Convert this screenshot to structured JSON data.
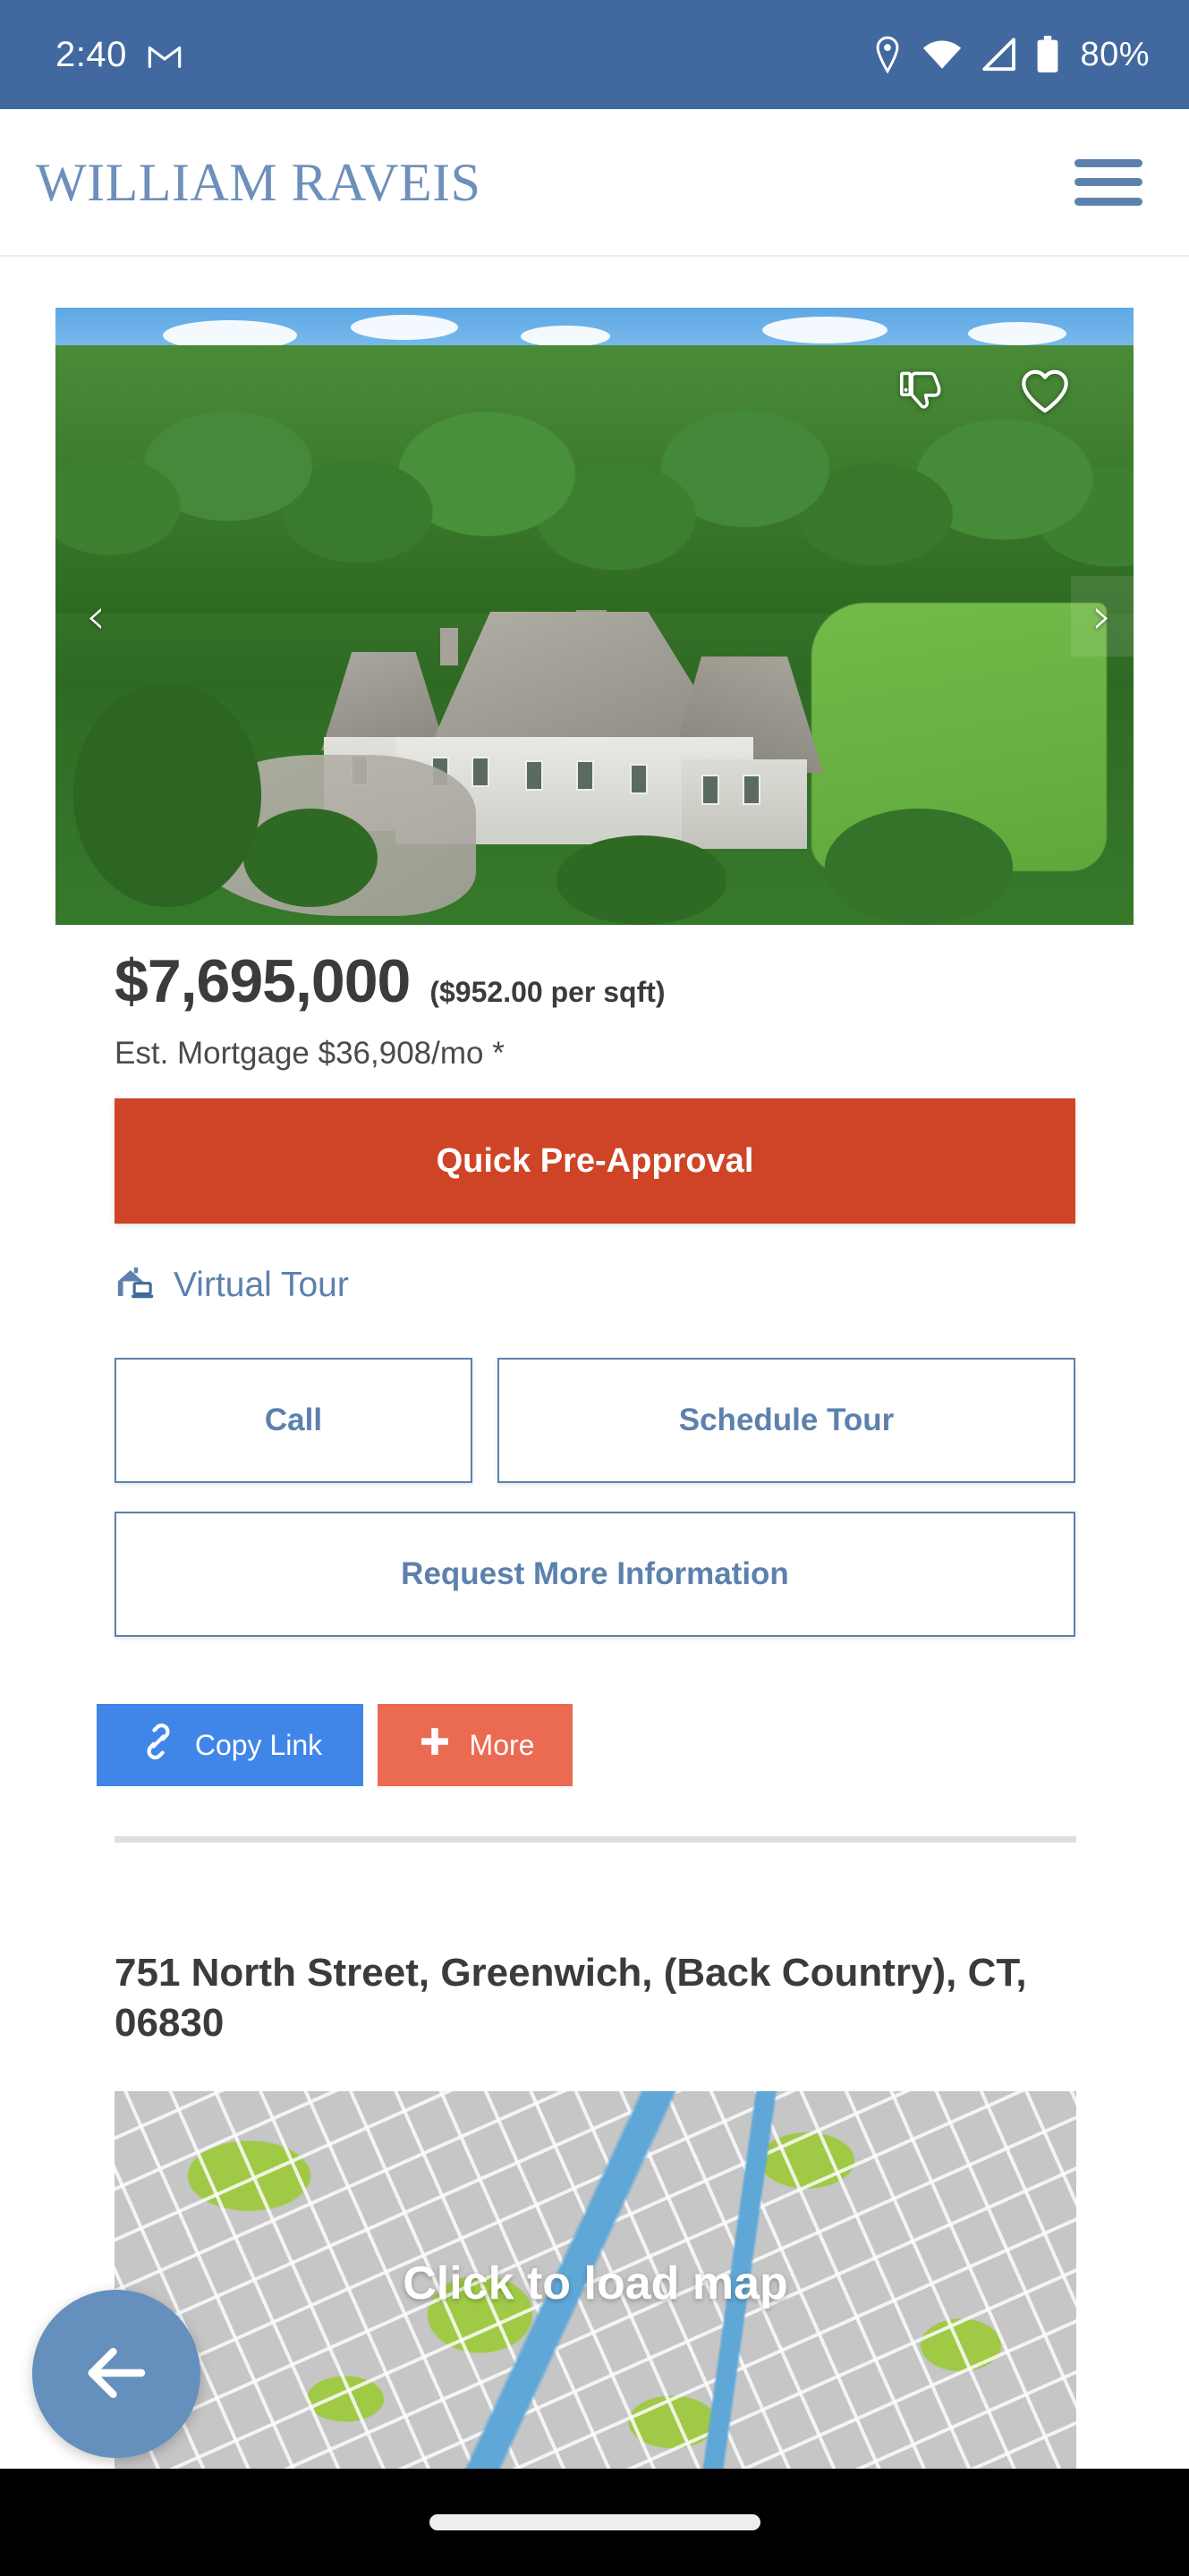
{
  "status_bar": {
    "time": "2:40",
    "gmail_icon": "gmail-icon",
    "location_icon": "location-pin-icon",
    "wifi_icon": "wifi-icon",
    "signal_icon": "cellular-signal-icon",
    "battery_icon": "battery-icon",
    "battery_text": "80%",
    "background_color": "#41699f"
  },
  "header": {
    "logo_text": "WILLIAM RAVEIS",
    "logo_color": "#6d8fbb",
    "menu_icon": "hamburger-menu-icon"
  },
  "gallery": {
    "prev_label": "‹",
    "next_label": "›",
    "dislike_icon": "thumbs-down-icon",
    "favorite_icon": "heart-icon",
    "alt": "Aerial view of large stone and shingle estate home surrounded by green trees and lawn"
  },
  "listing": {
    "price": "$7,695,000",
    "price_per_sqft": "($952.00 per sqft)",
    "mortgage": "Est. Mortgage $36,908/mo *",
    "address_line_1": "751 North Street, Greenwich, (Back",
    "address_line_2": "Country), CT, 06830",
    "address_full": "751 North Street, Greenwich, (Back Country), CT, 06830"
  },
  "actions": {
    "pre_approval_label": "Quick Pre-Approval",
    "pre_approval_color": "#cf4426",
    "virtual_tour_label": "Virtual Tour",
    "virtual_tour_icon": "house-laptop-icon",
    "call_label": "Call",
    "schedule_tour_label": "Schedule Tour",
    "request_info_label": "Request More Information",
    "outline_color": "#5d81ad"
  },
  "share": {
    "copy_link_label": "Copy Link",
    "copy_link_icon": "link-chain-icon",
    "copy_link_color": "#3f86e8",
    "more_label": "More",
    "more_icon": "plus-icon",
    "more_color": "#eb6a52"
  },
  "map": {
    "placeholder_label": "Click to load map"
  },
  "floating": {
    "back_icon": "arrow-left-icon",
    "back_color": "#6590bd"
  },
  "nav_bar": {
    "home_indicator": "home-indicator-pill"
  }
}
